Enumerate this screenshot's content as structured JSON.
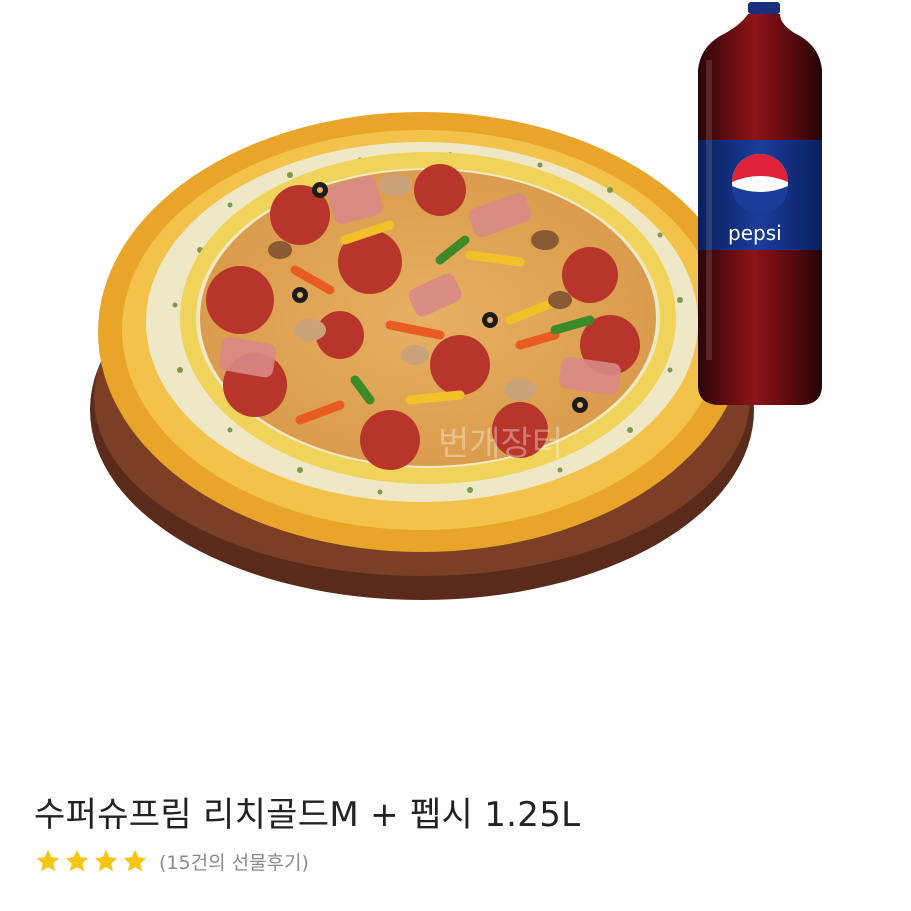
{
  "product": {
    "image_alt": "pizza-with-pepsi-bottle",
    "bottle_label": "pepsi",
    "watermark": "번개장터",
    "title": "수퍼슈프림 리치골드M + 펩시 1.25L"
  },
  "rating": {
    "stars_filled": 4,
    "stars_total": 4,
    "star_color": "#f5c518",
    "review_text": "(15건의 선물후기)"
  }
}
